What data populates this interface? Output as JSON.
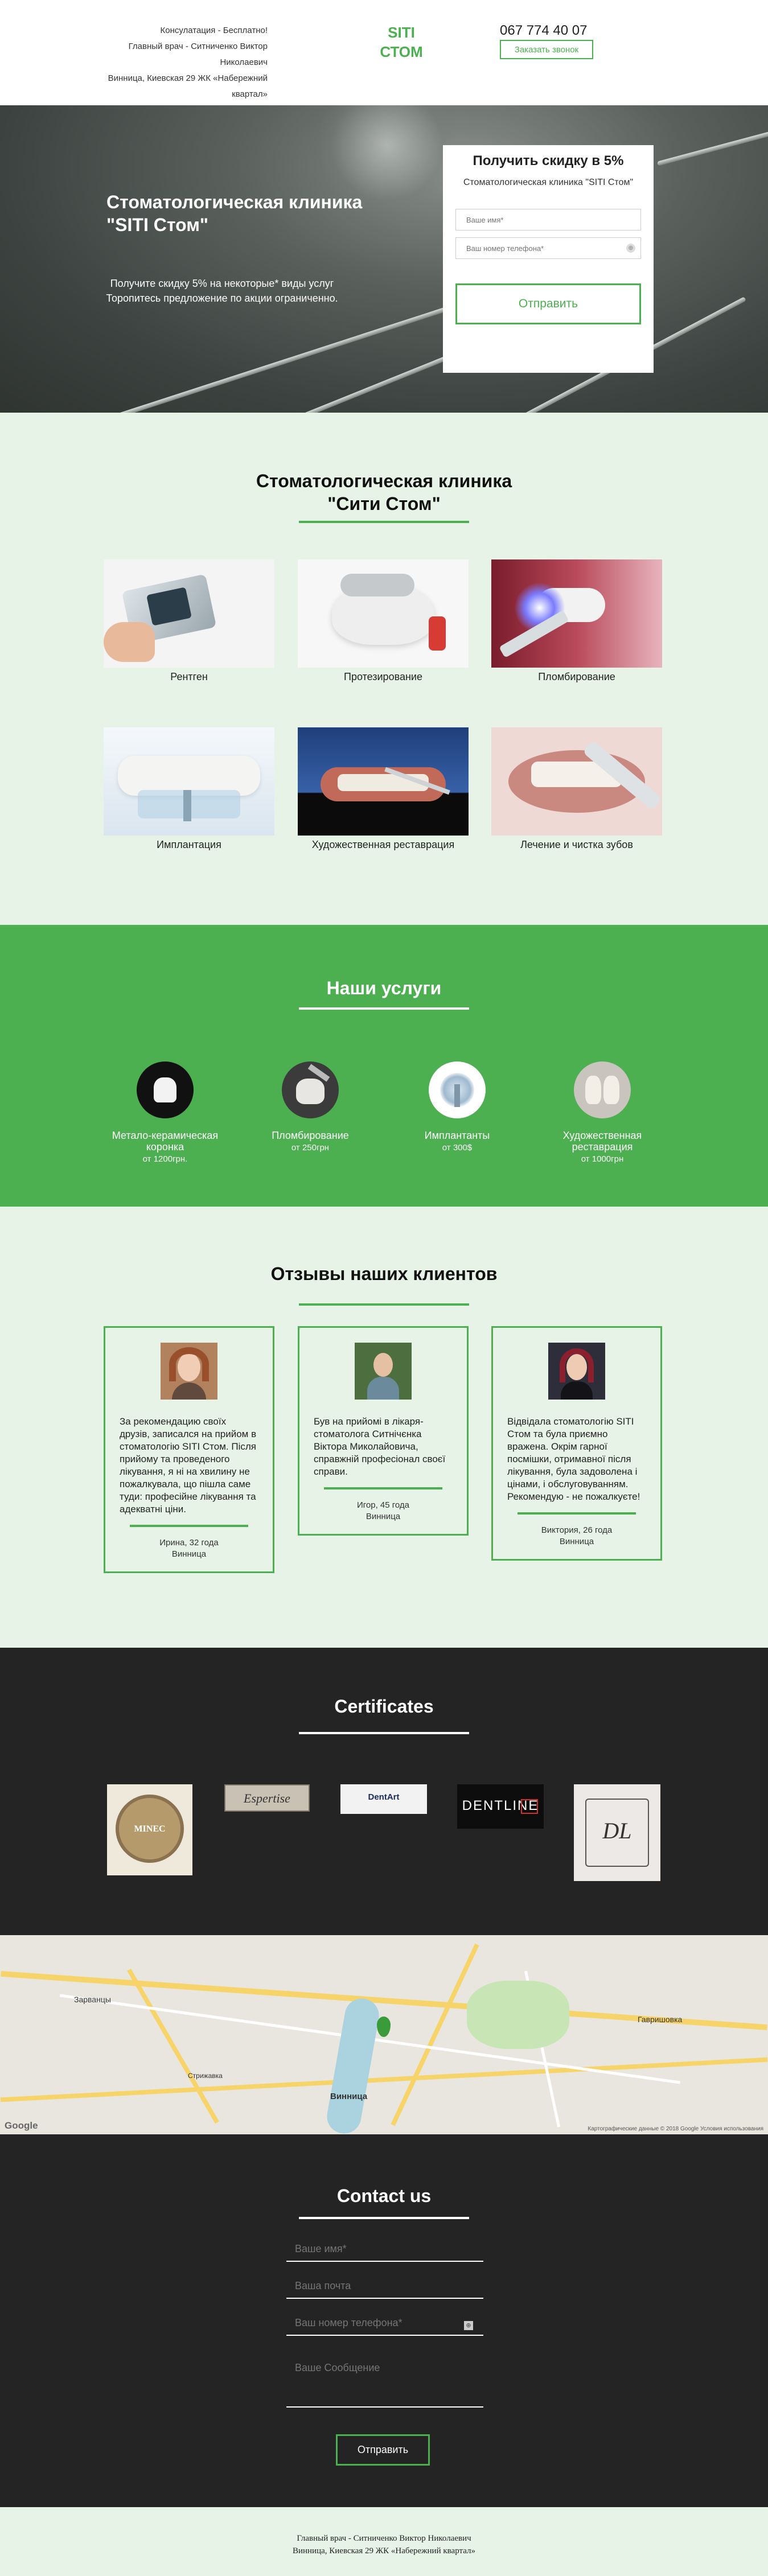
{
  "header": {
    "info_line1": "Консулатация - Бесплатно!",
    "info_line2": "Главный врач - Ситниченко Виктор Николаевич",
    "info_line3": "Винница, Киевская 29 ЖК «Набережний квартал»",
    "logo_line1": "SITI",
    "logo_line2": "СТОМ",
    "phone": "067 774 40 07",
    "callback_label": "Заказать звонок"
  },
  "hero": {
    "title_line1": "Стоматологическая клиника",
    "title_line2": "\"SITI Стом\"",
    "subtitle_line1": "Получите скидку 5% на некоторые* виды услуг",
    "subtitle_line2": "Торопитесь предложение по акции ограниченно."
  },
  "discount_form": {
    "title": "Получить скидку в 5%",
    "subtitle": "Стоматологическая клиника \"SITI Стом\"",
    "name_placeholder": "Ваше имя*",
    "phone_placeholder": "Ваш номер телефона*",
    "submit_label": "Отправить"
  },
  "clinic": {
    "title_line1": "Стоматологическая клиника",
    "title_line2": "\"Сити Стом\"",
    "items": [
      {
        "label": "Рентген"
      },
      {
        "label": "Протезирование"
      },
      {
        "label": "Пломбирование"
      },
      {
        "label": "Имплантация"
      },
      {
        "label": "Художественная реставрация"
      },
      {
        "label": "Лечение и чистка зубов"
      }
    ]
  },
  "services": {
    "title": "Наши услуги",
    "items": [
      {
        "name_line1": "Метало-керамическая",
        "name_line2": "коронка",
        "price": "от 1200грн."
      },
      {
        "name_line1": "Пломбирование",
        "name_line2": "",
        "price": "от 250грн"
      },
      {
        "name_line1": "Имплантанты",
        "name_line2": "",
        "price": "от 300$"
      },
      {
        "name_line1": "Художественная реставрация",
        "name_line2": "",
        "price": "от 1000грн"
      }
    ]
  },
  "reviews": {
    "title": "Отзывы наших клиентов",
    "items": [
      {
        "text": "За рекомендацию своїх друзів, записался на прийом в стоматологію SITI Стом. Після прийому та проведеного лікування, я ні на хвилину не пожалкувала, що пішла саме туди: професійне лікування та адекватні ціни.",
        "author_name": "Ирина, 32 года",
        "author_city": "Винница"
      },
      {
        "text": "Був на прийомі в лікаря-стоматолога Ситнічєнка Віктора Миколайовича, справжній професіонал своєї справи.",
        "author_name": "Игор, 45 года",
        "author_city": "Винница"
      },
      {
        "text": "Відвідала стоматологію SITI Стом та була приємно вражена. Окрім гарної посмішки, отримавної після лікування, була задоволена і цінами, і обслуговуванням. Рекомендую - не пожалкуєте!",
        "author_name": "Виктория, 26 года",
        "author_city": "Винница"
      }
    ]
  },
  "certificates": {
    "title": "Certificates",
    "items": [
      {
        "label": "MINEC"
      },
      {
        "label": "Espertise"
      },
      {
        "label": "DentArt"
      },
      {
        "label": "DENTLINE"
      },
      {
        "label": "DL"
      }
    ]
  },
  "map": {
    "labels": [
      "Зарванцы",
      "Винница",
      "Гавришовка",
      "Стрижавка"
    ],
    "google": "Google",
    "copyright": "Картографические данные © 2018 Google   Условия использования"
  },
  "contact": {
    "title": "Contact us",
    "name_placeholder": "Ваше имя*",
    "email_placeholder": "Ваша почта",
    "phone_placeholder": "Ваш номер телефона*",
    "message_placeholder": "Ваше Сообщение",
    "submit_label": "Отправить"
  },
  "footer": {
    "line1": "Главный врач - Ситниченко Виктор Николаевич",
    "line2": "Винница, Киевская 29 ЖК «Набережний квартал»"
  },
  "colors": {
    "accent": "#4caf50",
    "light_bg": "#e6f3e6",
    "dark_bg": "#242424"
  }
}
